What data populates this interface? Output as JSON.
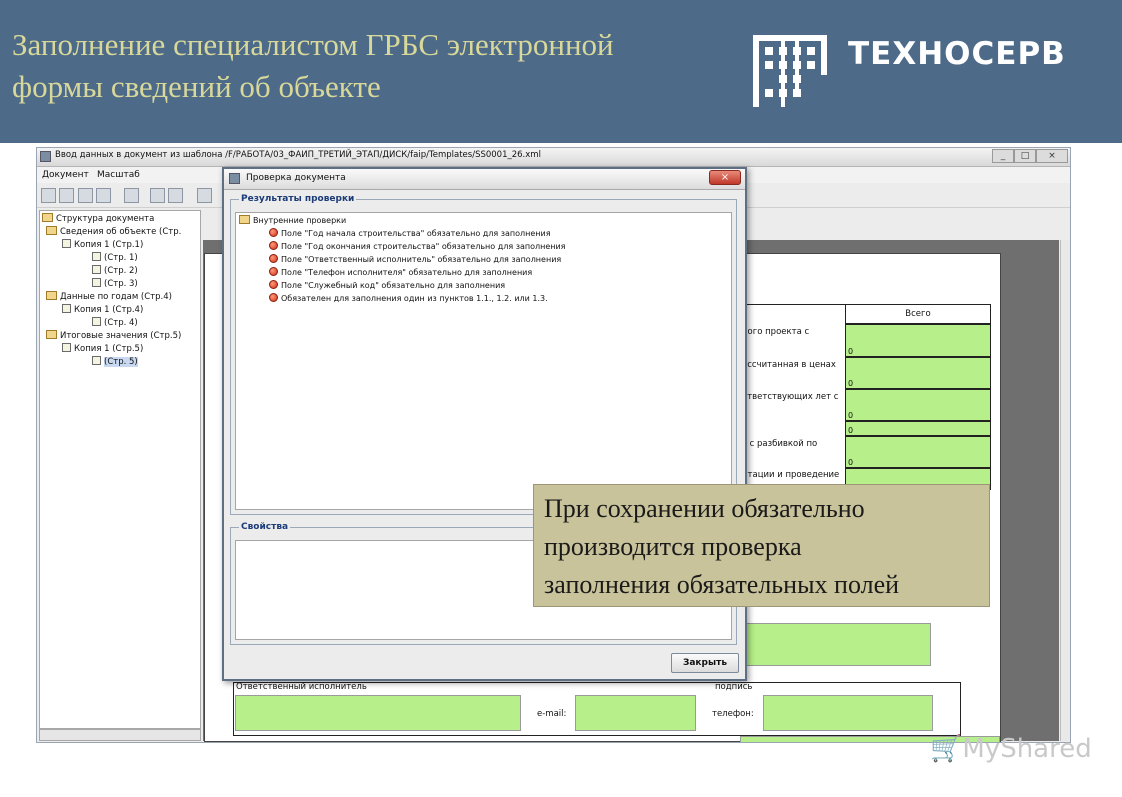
{
  "banner": {
    "title_line1": "Заполнение специалистом ГРБС электронной",
    "title_line2": "формы сведений об объекте",
    "logo_text": "ТЕХНОСЕРВ",
    "bg_color": "#4d6a89",
    "title_color": "#d8d89a"
  },
  "app": {
    "title": "Ввод данных в документ из шаблона /F/РАБОТА/03_ФАИП_ТРЕТИЙ_ЭТАП/ДИСК/faip/Templates/SS0001_26.xml",
    "window_buttons": [
      "_",
      "□",
      "×"
    ],
    "menu": [
      "Документ",
      "Масштаб"
    ],
    "tree": [
      {
        "label": "Структура документа",
        "icon": "folder-icon"
      },
      {
        "label": "Сведения об объекте (Стр.",
        "icon": "folder-icon"
      },
      {
        "label": "Копия 1 (Стр.1)",
        "icon": "copy-icon"
      },
      {
        "label": "(Стр. 1)",
        "icon": "page-icon"
      },
      {
        "label": "(Стр. 2)",
        "icon": "page-icon"
      },
      {
        "label": "(Стр. 3)",
        "icon": "page-icon"
      },
      {
        "label": "Данные по годам (Стр.4)",
        "icon": "folder-icon"
      },
      {
        "label": "Копия 1 (Стр.4)",
        "icon": "copy-icon"
      },
      {
        "label": "(Стр. 4)",
        "icon": "page-icon"
      },
      {
        "label": "Итоговые значения (Стр.5)",
        "icon": "folder-icon"
      },
      {
        "label": "Копия 1 (Стр.5)",
        "icon": "copy-icon"
      },
      {
        "label": "(Стр. 5)",
        "icon": "page-icon"
      }
    ],
    "form": {
      "header_total": "Всего",
      "rows": [
        {
          "label": "ного проекта с",
          "value": "0"
        },
        {
          "label": "ассчитанная в ценах",
          "value": "0"
        },
        {
          "label": "ответствующих лет с",
          "value": "0"
        },
        {
          "label": "",
          "value": "0"
        },
        {
          "label": "т с разбивкой по",
          "value": "0"
        },
        {
          "label": "нтации и проведение",
          "value": ""
        }
      ],
      "executor_label": "Ответственный исполнитель",
      "signature_label": "подпись",
      "email_label": "e-mail:",
      "phone_label": "телефон:"
    }
  },
  "dialog": {
    "title": "Проверка документа",
    "close_glyph": "×",
    "results_legend": "Результаты проверки",
    "root_node": "Внутренние проверки",
    "errors": [
      "Поле \"Год начала строительства\" обязательно для заполнения",
      "Поле \"Год окончания строительства\" обязательно для заполнения",
      "Поле \"Ответственный исполнитель\" обязательно для заполнения",
      "Поле \"Телефон исполнителя\" обязательно для заполнения",
      "Поле \"Служебный код\" обязательно для заполнения",
      "Обязателен для заполнения один из пунктов 1.1., 1.2. или 1.3."
    ],
    "properties_legend": "Свойства",
    "close_button": "Закрыть"
  },
  "callout": {
    "line1": "При сохранении обязательно",
    "line2": "производится проверка",
    "line3": "заполнения обязательных полей",
    "bg_color": "#c9c39b"
  },
  "watermark": "MyShared",
  "colors": {
    "field_green": "#b7f08a",
    "legend_blue": "#1b3c78"
  }
}
